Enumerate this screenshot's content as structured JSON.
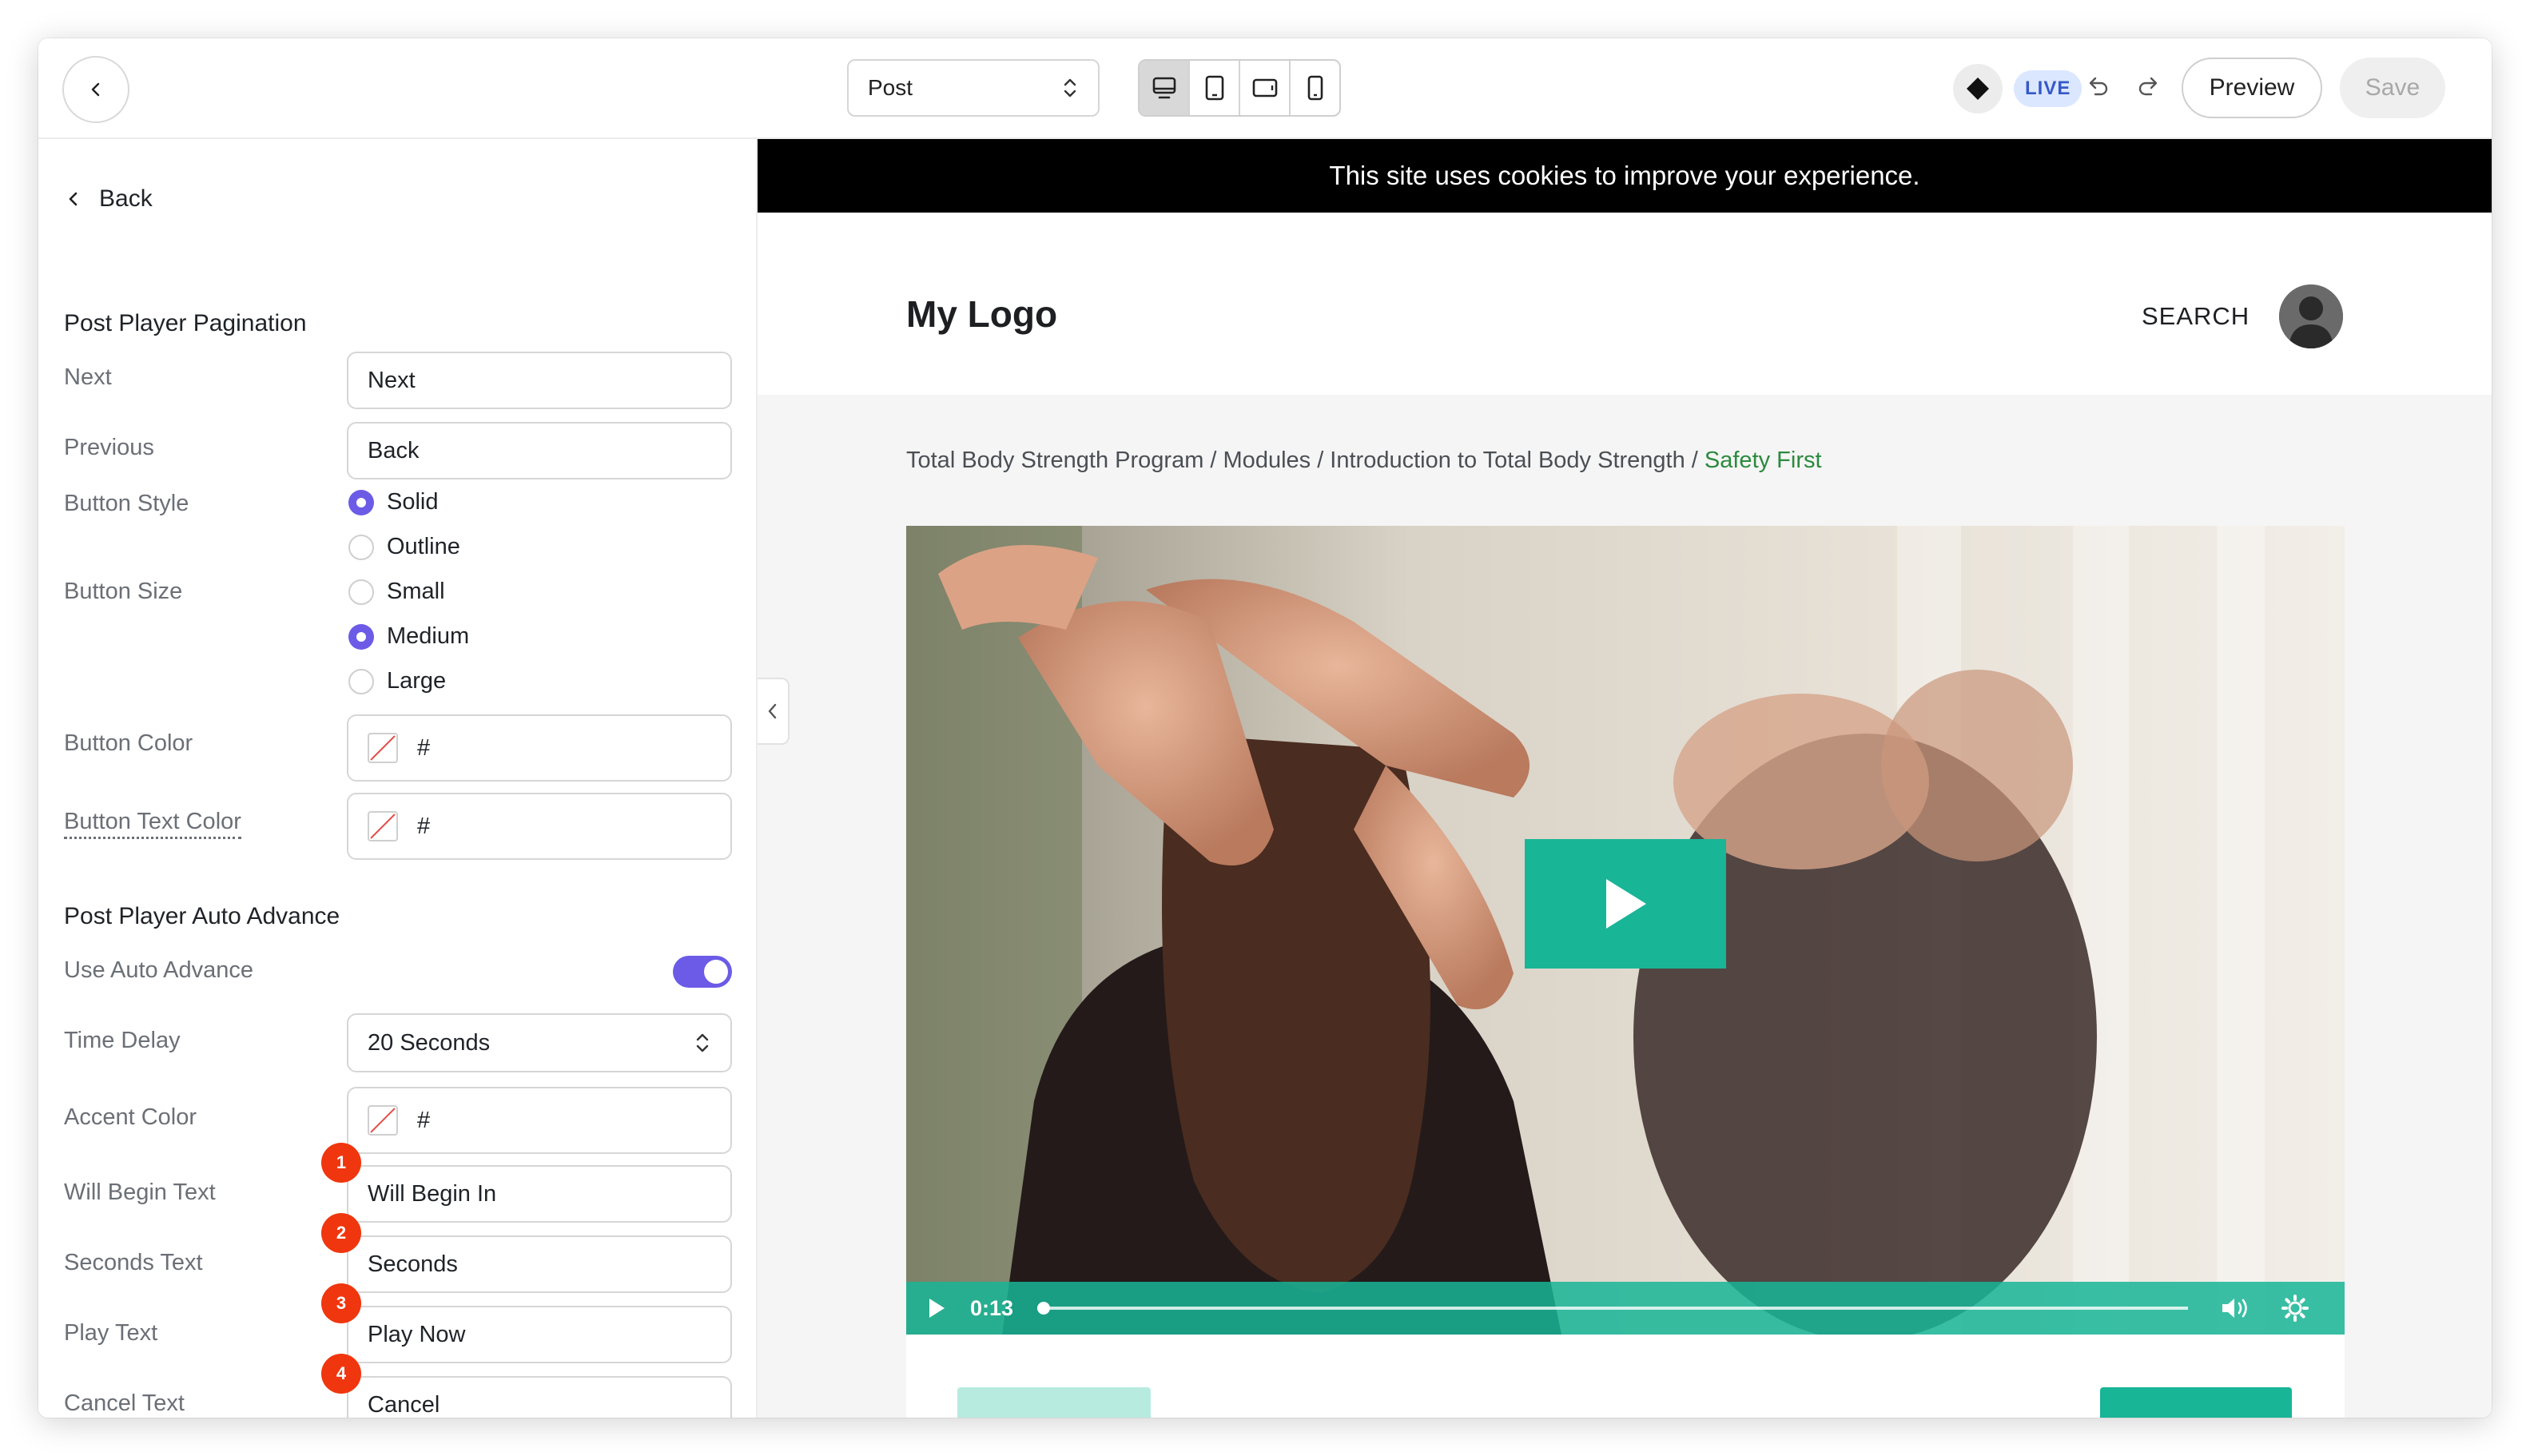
{
  "toolbar": {
    "page_select": "Post",
    "live_label": "LIVE",
    "preview_label": "Preview",
    "save_label": "Save"
  },
  "panel": {
    "back_label": "Back",
    "pagination": {
      "title": "Post Player Pagination",
      "next_label": "Next",
      "next_value": "Next",
      "previous_label": "Previous",
      "previous_value": "Back",
      "style_label": "Button Style",
      "style_options": [
        "Solid",
        "Outline"
      ],
      "style_selected": "Solid",
      "size_label": "Button Size",
      "size_options": [
        "Small",
        "Medium",
        "Large"
      ],
      "size_selected": "Medium",
      "color_label": "Button Color",
      "color_value": "#",
      "text_color_label": "Button Text Color",
      "text_color_value": "#"
    },
    "auto_advance": {
      "title": "Post Player Auto Advance",
      "use_label": "Use Auto Advance",
      "use_enabled": true,
      "delay_label": "Time Delay",
      "delay_value": "20 Seconds",
      "accent_label": "Accent Color",
      "accent_value": "#",
      "will_begin_label": "Will Begin Text",
      "will_begin_value": "Will Begin In",
      "seconds_label": "Seconds Text",
      "seconds_value": "Seconds",
      "play_label": "Play Text",
      "play_value": "Play Now",
      "cancel_label": "Cancel Text",
      "cancel_value": "Cancel"
    },
    "badges": [
      "1",
      "2",
      "3",
      "4"
    ]
  },
  "site": {
    "cookie_text": "This site uses cookies to improve your experience.",
    "logo": "My Logo",
    "search": "SEARCH",
    "breadcrumb": {
      "path": "Total Body Strength Program / Modules / Introduction to Total Body Strength / ",
      "current": "Safety First"
    },
    "video": {
      "time": "0:13",
      "progress": 0.0
    }
  },
  "colors": {
    "accent": "#6b5be6",
    "player": "#18b596",
    "badge": "#f0360e",
    "breadcrumb_current": "#2b8a3e"
  }
}
